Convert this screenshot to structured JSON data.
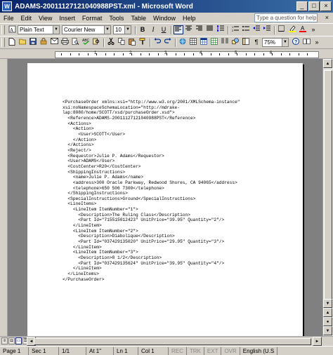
{
  "window": {
    "title": "ADAMS-20011127121040988PST.xml - Microsoft Word",
    "app_icon_letter": "W",
    "min": "_",
    "max": "□",
    "close": "×"
  },
  "menu": {
    "items": [
      "File",
      "Edit",
      "View",
      "Insert",
      "Format",
      "Tools",
      "Table",
      "Window",
      "Help"
    ],
    "help_placeholder": "Type a question for help",
    "close_doc": "×"
  },
  "formatting": {
    "style": "Plain Text",
    "font": "Courier New",
    "size": "10",
    "bold": "B",
    "italic": "I",
    "underline": "U"
  },
  "standard": {
    "zoom": "75%"
  },
  "document": {
    "lines": [
      "<PurchaseOrder xmlns:xsi=\"http://www.w3.org/2001/XMLSchema-instance\"",
      "xsi:noNamespaceSchemaLocation=\"http://mdrake-",
      "lap:8080/home/SCOTT/xsd/purchaseOrder.xsd\">",
      "  <Reference>ADAMS-20011127121040988PST</Reference>",
      "  <Actions>",
      "    <Action>",
      "      <User>SCOTT</User>",
      "    </Action>",
      "  </Actions>",
      "  <Reject/>",
      "  <Requestor>Julie P. Adams</Requestor>",
      "  <User>ADAMS</User>",
      "  <CostCenter>R20</CostCenter>",
      "  <ShippingInstructions>",
      "    <name>Julie P. Adams</name>",
      "    <address>300 Oracle Parkway, Redwood Shores, CA 94065</address>",
      "    <telephone>650 506 7300</telephone>",
      "  </ShippingInstructions>",
      "  <SpecialInstructions>Ground</SpecialInstructions>",
      "  <LineItems>",
      "    <LineItem ItemNumber=\"1\">",
      "      <Description>The Ruling Class</Description>",
      "      <Part Id=\"715515012423\" UnitPrice=\"39.95\" Quantity=\"2\"/>",
      "    </LineItem>",
      "    <LineItem ItemNumber=\"2\">",
      "      <Description>Diabolique</Description>",
      "      <Part Id=\"037429135020\" UnitPrice=\"29.95\" Quantity=\"3\"/>",
      "    </LineItem>",
      "    <LineItem ItemNumber=\"3\">",
      "      <Description>8 1/2</Description>",
      "      <Part Id=\"037429135624\" UnitPrice=\"39.95\" Quantity=\"4\"/>",
      "    </LineItem>",
      "  </LineItems>",
      "</PurchaseOrder>"
    ]
  },
  "ruler": {
    "numbers": [
      "1",
      "2",
      "3",
      "4",
      "5",
      "6"
    ]
  },
  "status": {
    "page": "Page 1",
    "sec": "Sec 1",
    "pages": "1/1",
    "at": "At 1\"",
    "ln": "Ln 1",
    "col": "Col 1",
    "rec": "REC",
    "trk": "TRK",
    "ext": "EXT",
    "ovr": "OVR",
    "language": "English (U.S"
  }
}
